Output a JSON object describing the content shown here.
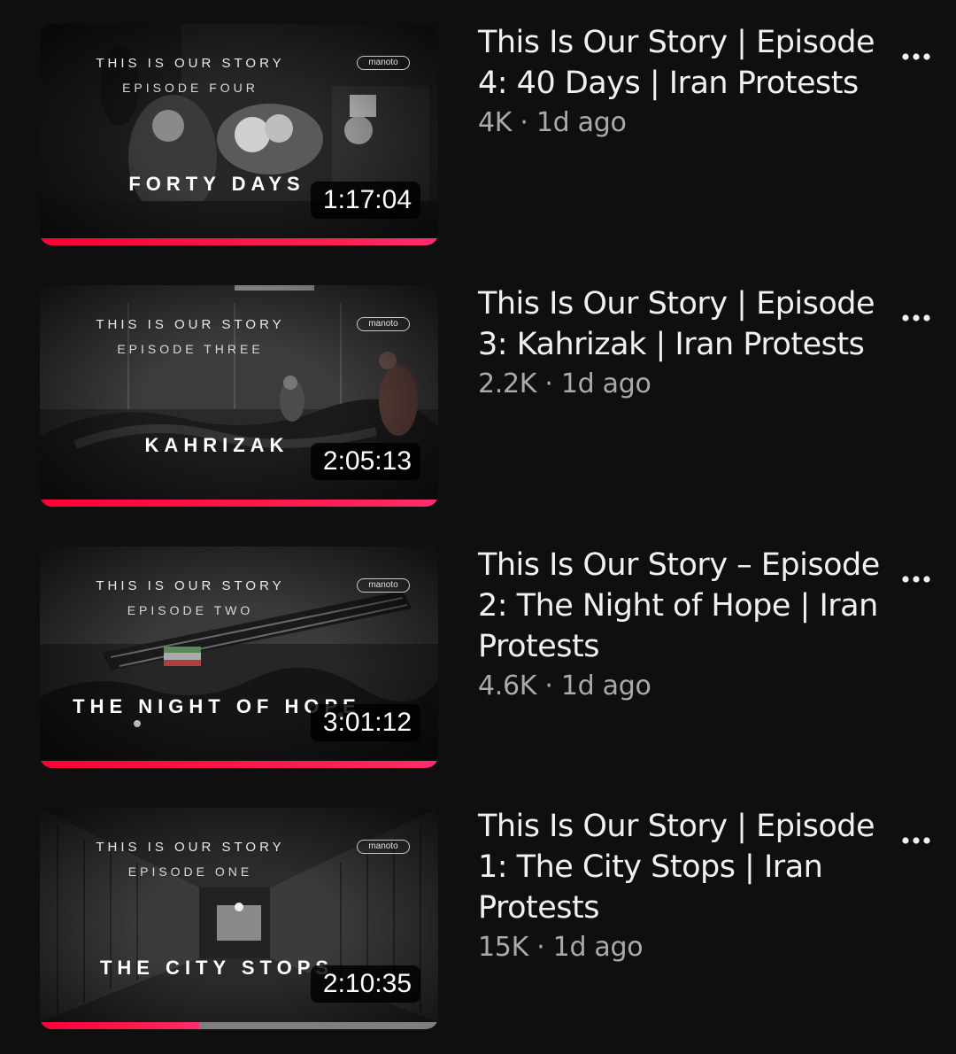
{
  "colors": {
    "background": "#0f0f0f",
    "progress": "#ff0033",
    "title": "#f1f1f1",
    "meta": "#aaaaaa"
  },
  "videos": [
    {
      "thumb": {
        "series": "THIS IS OUR STORY",
        "episode": "EPISODE FOUR",
        "logo": "manoto",
        "title": "FORTY DAYS"
      },
      "duration": "1:17:04",
      "progress_fraction": 1.0,
      "title": "This Is Our Story | Episode 4: 40 Days | Iran Protests",
      "meta": "4K · 1d ago",
      "menu_icon": "more-vertical-icon"
    },
    {
      "thumb": {
        "series": "THIS IS OUR STORY",
        "episode": "EPISODE THREE",
        "logo": "manoto",
        "title": "KAHRIZAK"
      },
      "duration": "2:05:13",
      "progress_fraction": 1.0,
      "title": "This Is Our Story | Episode 3: Kahrizak | Iran Protests",
      "meta": "2.2K · 1d ago",
      "menu_icon": "more-vertical-icon"
    },
    {
      "thumb": {
        "series": "THIS IS OUR STORY",
        "episode": "EPISODE TWO",
        "logo": "manoto",
        "title": "THE NIGHT OF HOPE"
      },
      "duration": "3:01:12",
      "progress_fraction": 1.0,
      "title": "This Is Our Story – Episode 2: The Night of Hope | Iran Protests",
      "meta": "4.6K · 1d ago",
      "menu_icon": "more-vertical-icon"
    },
    {
      "thumb": {
        "series": "THIS IS OUR STORY",
        "episode": "EPISODE ONE",
        "logo": "manoto",
        "title": "THE CITY STOPS"
      },
      "duration": "2:10:35",
      "progress_fraction": 0.4,
      "title": "This Is Our Story | Episode 1: The City Stops | Iran Protests",
      "meta": "15K · 1d ago",
      "menu_icon": "more-vertical-icon"
    }
  ]
}
